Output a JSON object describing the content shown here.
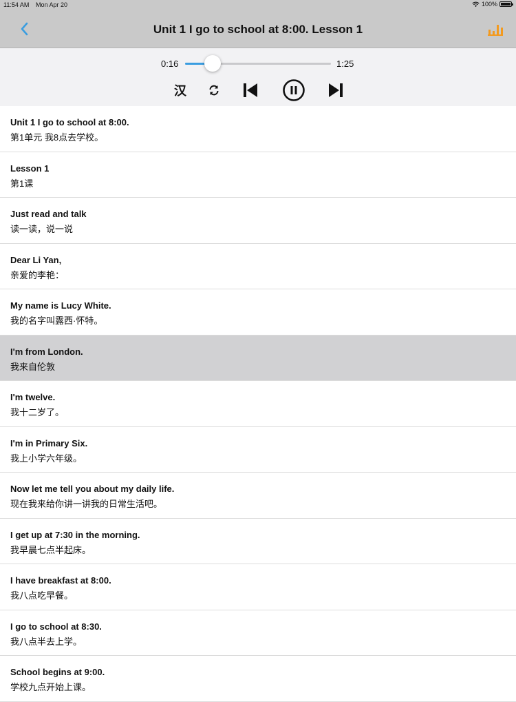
{
  "status_bar": {
    "time": "11:54 AM",
    "date": "Mon Apr 20",
    "battery": "100%"
  },
  "nav": {
    "title": "Unit 1 I go to school at 8:00. Lesson 1",
    "accent_color": "#3a9de0",
    "stats_color": "#f39a1e"
  },
  "player": {
    "current_time": "0:16",
    "total_time": "1:25",
    "progress_fraction": 0.19,
    "toggle_label": "汉",
    "icons": [
      "repeat-icon",
      "skip-previous-icon",
      "pause-icon",
      "skip-next-icon"
    ]
  },
  "selected_index": 5,
  "sentences": [
    {
      "en": "Unit 1 I go to school at 8:00.",
      "zh": "第1单元 我8点去学校。"
    },
    {
      "en": "Lesson 1",
      "zh": "第1课"
    },
    {
      "en": "Just read and talk",
      "zh": "读一读，说一说"
    },
    {
      "en": "Dear Li Yan,",
      "zh": "亲爱的李艳："
    },
    {
      "en": "My name is Lucy White.",
      "zh": "我的名字叫露西·怀特。"
    },
    {
      "en": "I'm from London.",
      "zh": "我来自伦敦"
    },
    {
      "en": "I'm twelve.",
      "zh": "我十二岁了。"
    },
    {
      "en": "I'm in Primary Six.",
      "zh": "我上小学六年级。"
    },
    {
      "en": "Now let me tell you about my daily life.",
      "zh": "现在我来给你讲一讲我的日常生活吧。"
    },
    {
      "en": "I get up at 7:30 in the morning.",
      "zh": "我早晨七点半起床。"
    },
    {
      "en": "I have breakfast at 8:00.",
      "zh": "我八点吃早餐。"
    },
    {
      "en": "I go to school at 8:30.",
      "zh": "我八点半去上学。"
    },
    {
      "en": "School begins at 9:00.",
      "zh": "学校九点开始上课。"
    }
  ]
}
